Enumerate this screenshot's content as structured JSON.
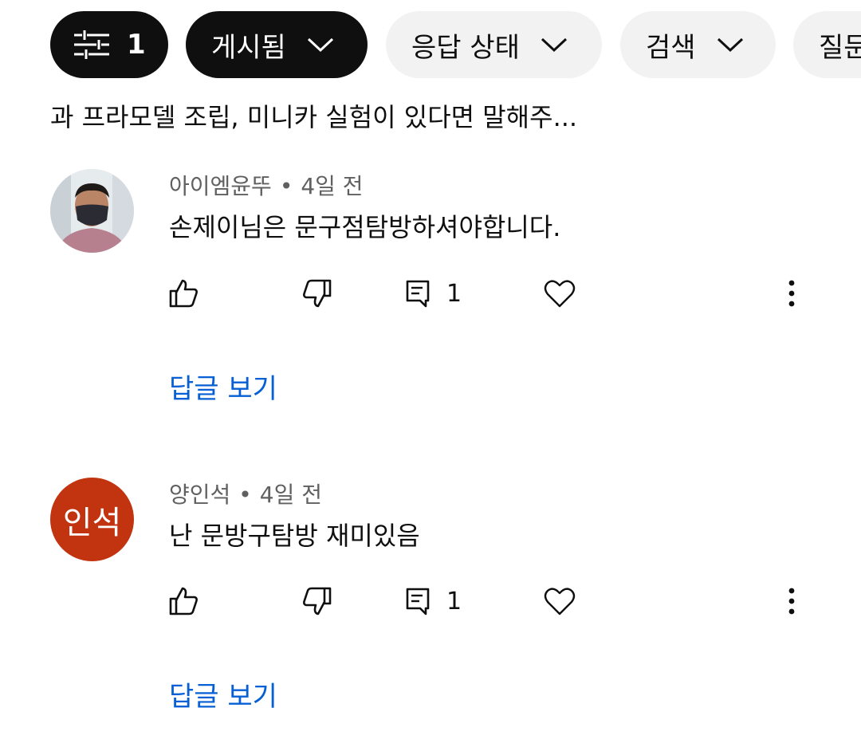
{
  "filter_bar": {
    "filter_count": "1",
    "chips": {
      "posted": "게시됨",
      "reply_status": "응답 상태",
      "search": "검색",
      "question": "질문"
    }
  },
  "intro_text": "과 프라모델 조립, 미니카 실험이 있다면 말해주...",
  "comments": [
    {
      "author": "아이엠윤뚜",
      "age": "4일 전",
      "separator": "•",
      "text": "손제이님은 문구점탐방하셔야합니다.",
      "reply_count": "1",
      "view_replies_label": "답글 보기",
      "avatar": {
        "type": "photo"
      }
    },
    {
      "author": "양인석",
      "age": "4일 전",
      "separator": "•",
      "text": "난 문방구탐방 재미있음",
      "reply_count": "1",
      "view_replies_label": "답글 보기",
      "avatar": {
        "type": "initials",
        "initials": "인석",
        "color": "#c2330f"
      }
    }
  ],
  "colors": {
    "chip_active_bg": "#0f0f0f",
    "chip_inactive_bg": "#f2f2f2",
    "link_blue": "#065fd4",
    "meta_gray": "#606060"
  }
}
